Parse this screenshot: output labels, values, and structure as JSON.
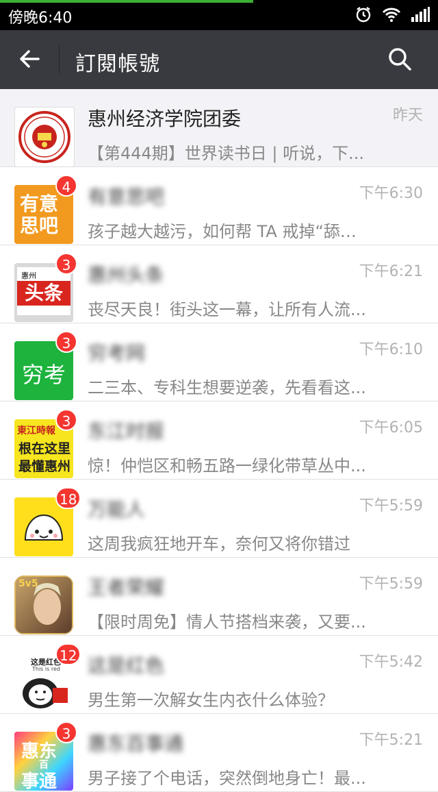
{
  "status": {
    "time": "傍晚6:40"
  },
  "header": {
    "title": "訂閱帳號"
  },
  "colors": {
    "accent_green": "#3cb034",
    "badge_red": "#f43530",
    "header_bg": "#393a3f"
  },
  "items": [
    {
      "name": "惠州经济学院团委",
      "preview": "【第444期】世界读书日 | 听说，下...",
      "time": "昨天",
      "badge": ""
    },
    {
      "name": "有意思吧",
      "preview": "孩子越大越污，如何帮 TA 戒掉“舔屏...",
      "time": "下午6:30",
      "badge": "4"
    },
    {
      "name": "惠州头条",
      "preview": "丧尽天良！街头这一幕，让所有人流...",
      "time": "下午6:21",
      "badge": "3"
    },
    {
      "name": "穷考网",
      "preview": "二三本、专科生想要逆袭，先看看这...",
      "time": "下午6:10",
      "badge": "3"
    },
    {
      "name": "东江时报",
      "preview": "惊！仲恺区和畅五路一绿化带草丛中...",
      "time": "下午6:05",
      "badge": "3"
    },
    {
      "name": "万能人",
      "preview": "这周我疯狂地开车，奈何又将你错过",
      "time": "下午5:59",
      "badge": "18"
    },
    {
      "name": "王者荣耀",
      "preview": "【限时周免】情人节搭档来袭，又要...",
      "time": "下午5:59",
      "badge": ""
    },
    {
      "name": "这是红色",
      "preview": "男生第一次解女生内衣什么体验？",
      "time": "下午5:42",
      "badge": "12"
    },
    {
      "name": "惠东百事通",
      "preview": "男子接了个电话，突然倒地身亡！最...",
      "time": "下午5:21",
      "badge": "3"
    }
  ],
  "avatars": {
    "a1_text": "",
    "a2_text_line1": "有意",
    "a2_text_line2": "思吧",
    "a3_small": "惠州",
    "a3_text": "头条",
    "a4_text": "穷考",
    "a5_line1": "東江時報",
    "a5_line2": "根在这里",
    "a5_line3": "最懂惠州",
    "a7_text": "5v5",
    "a8_text": "这是红色",
    "a8_sub": "This is red",
    "a9_line1": "惠东",
    "a9_line2": "事通",
    "a9_mid": "百"
  }
}
